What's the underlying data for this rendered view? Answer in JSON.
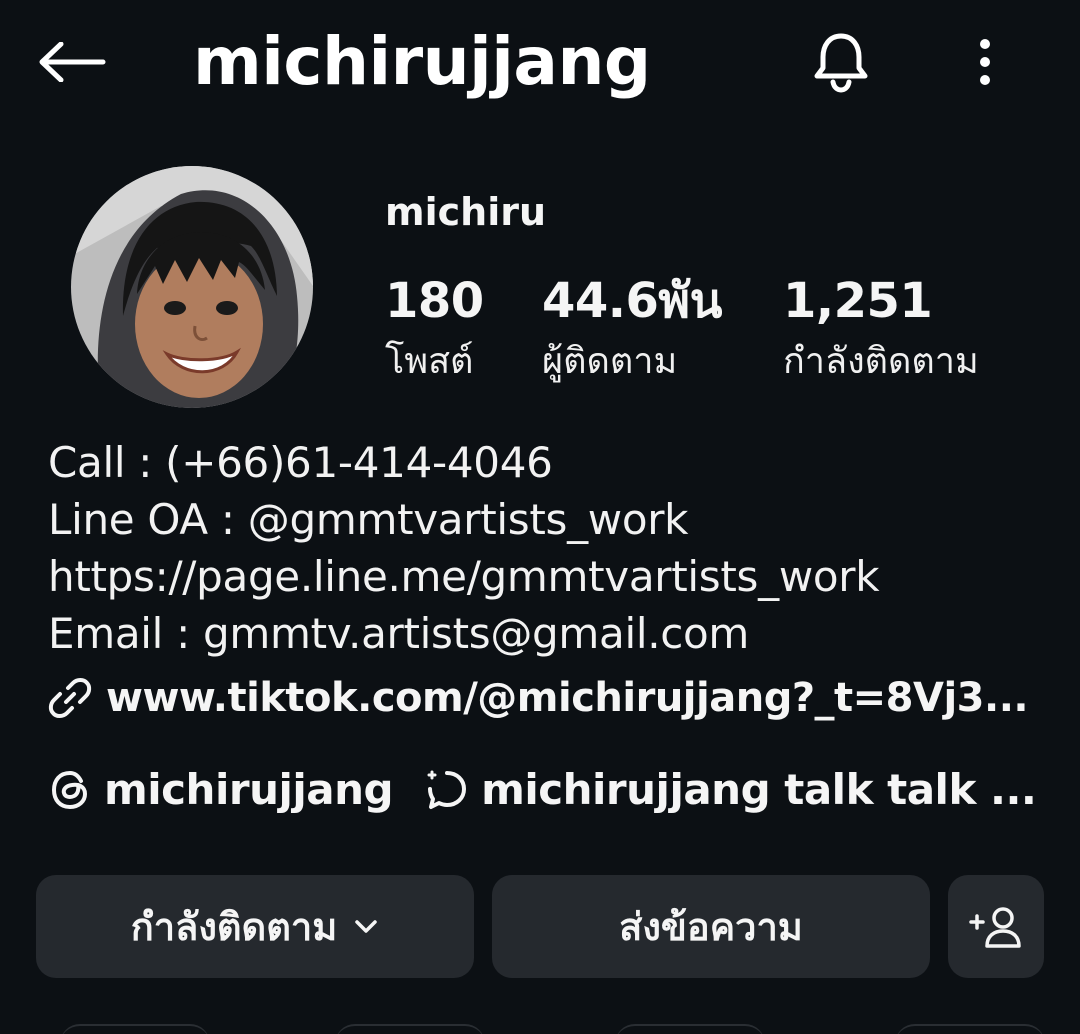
{
  "header": {
    "username": "michirujjang",
    "back_icon": "arrow-left-icon",
    "bell_icon": "bell-icon",
    "more_icon": "more-vertical-icon"
  },
  "profile": {
    "display_name": "michiru",
    "avatar_icon": "profile-photo-avatar",
    "stats": {
      "posts": {
        "value": "180",
        "label": "โพสต์"
      },
      "followers": {
        "value": "44.6พัน",
        "label": "ผู้ติดตาม"
      },
      "following": {
        "value": "1,251",
        "label": "กำลังติดตาม"
      }
    }
  },
  "bio": {
    "lines": [
      "Call : (+66)61-414-4046",
      "Line OA : @gmmtvartists_work",
      "https://page.line.me/gmmtvartists_work",
      "Email : gmmtv.artists@gmail.com"
    ],
    "link_icon": "link-icon",
    "link": "www.tiktok.com/@michirujjang?_t=8Vj3..."
  },
  "social": {
    "threads": {
      "icon": "threads-icon",
      "label": "michirujjang"
    },
    "channel": {
      "icon": "chat-bubble-icon",
      "label": "michirujjang talk talk ..."
    }
  },
  "actions": {
    "following_label": "กำลังติดตาม",
    "message_label": "ส่งข้อความ",
    "chevron_icon": "chevron-down-icon",
    "add_user_icon": "add-user-icon"
  },
  "colors": {
    "background": "#0c1014",
    "button_bg": "#25292e",
    "text": "#f5f5f5"
  }
}
